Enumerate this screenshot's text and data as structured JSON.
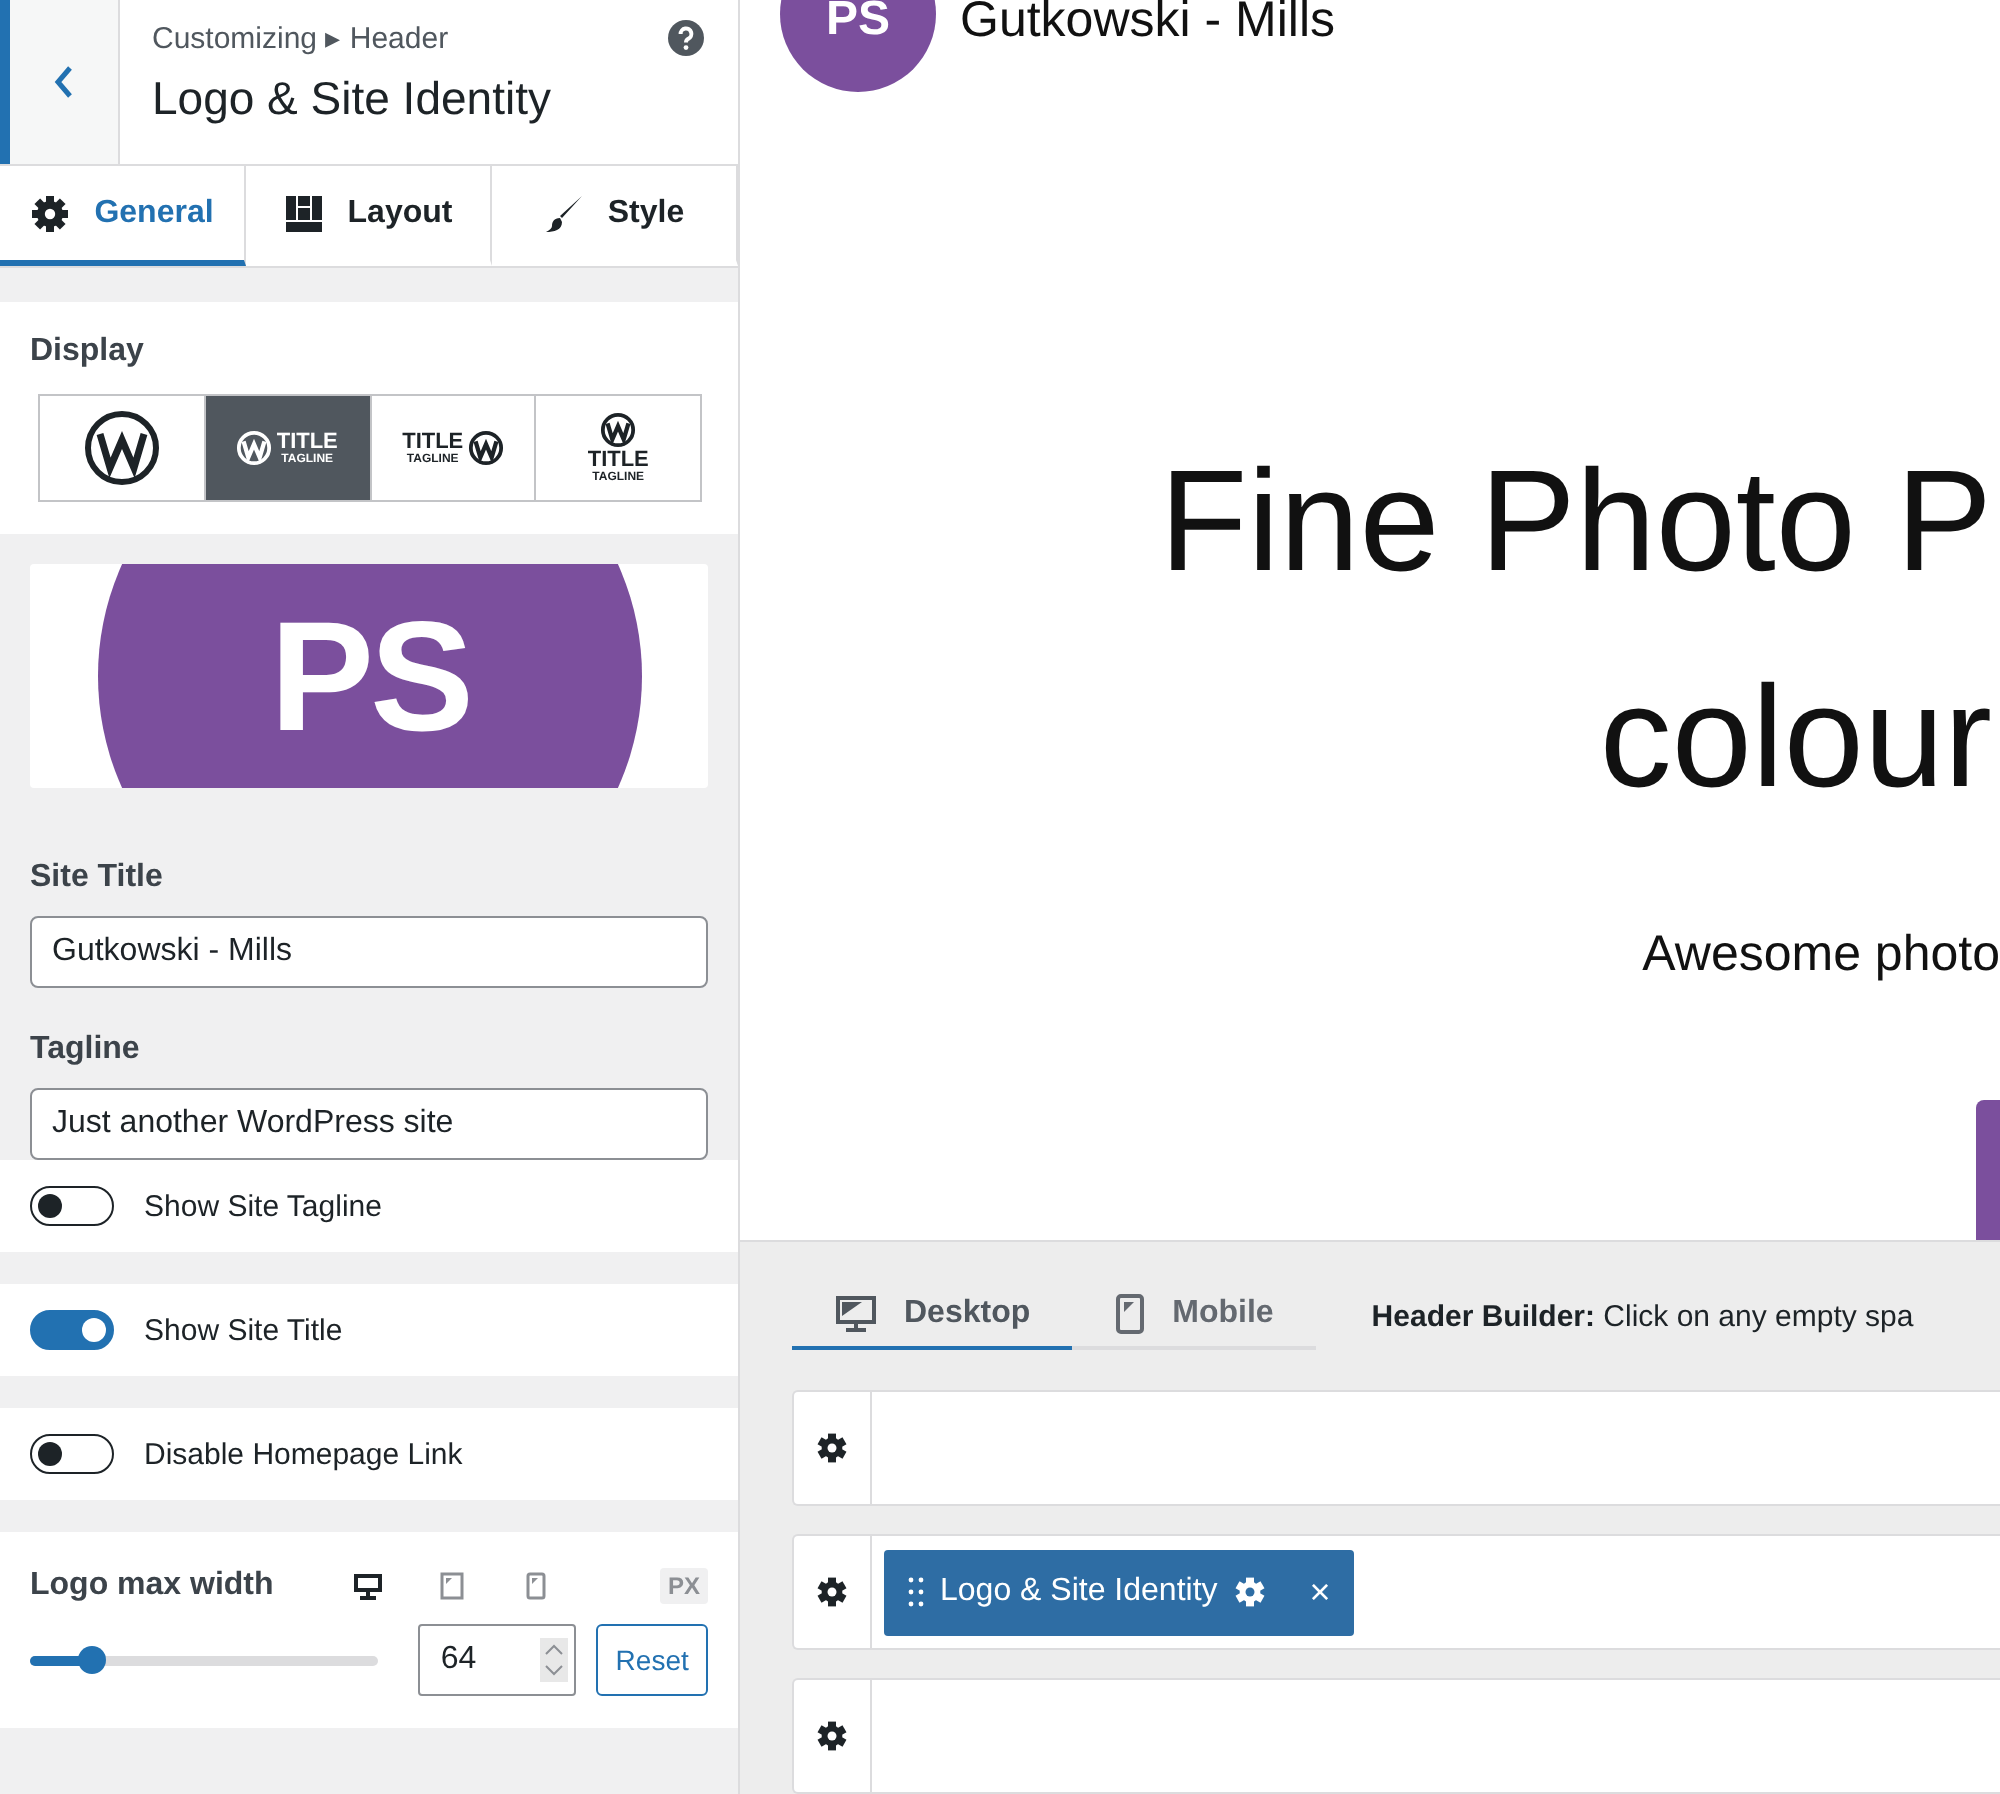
{
  "header": {
    "breadcrumb": "Customizing ▸ Header",
    "title": "Logo & Site Identity"
  },
  "tabs": [
    {
      "label": "General",
      "kind": "gear",
      "selected": true
    },
    {
      "label": "Layout",
      "kind": "layout",
      "selected": false
    },
    {
      "label": "Style",
      "kind": "brush",
      "selected": false
    }
  ],
  "display": {
    "label": "Display",
    "options": [
      {
        "kind": "logo",
        "selected": false
      },
      {
        "kind": "logo_left",
        "title": "TITLE",
        "tagline": "TAGLINE",
        "selected": true
      },
      {
        "kind": "logo_right",
        "title": "TITLE",
        "tagline": "TAGLINE",
        "selected": false
      },
      {
        "kind": "logo_top",
        "title": "TITLE",
        "tagline": "TAGLINE",
        "selected": false
      }
    ]
  },
  "logo": {
    "text": "PS"
  },
  "fields": [
    {
      "label": "Site Title",
      "value": "Gutkowski - Mills"
    },
    {
      "label": "Tagline",
      "value": "Just another WordPress site"
    }
  ],
  "toggles": [
    {
      "label": "Show Site Tagline",
      "on": false
    },
    {
      "label": "Show Site Title",
      "on": true
    },
    {
      "label": "Disable Homepage Link",
      "on": false
    }
  ],
  "logo_width": {
    "label": "Logo max width",
    "devices": [
      {
        "kind": "desktop",
        "selected": true
      },
      {
        "kind": "tablet",
        "selected": false
      },
      {
        "kind": "mobile",
        "selected": false
      }
    ],
    "unit": "PX",
    "level": 0.18,
    "value": "64",
    "reset": "Reset"
  },
  "preview": {
    "logo_text": "PS",
    "site_title": "Gutkowski - Mills",
    "heading_lines": [
      "Fine Photo P",
      "colour"
    ],
    "subtitle": "Awesome photo"
  },
  "builder": {
    "tabs": [
      {
        "label": "Desktop",
        "kind": "desktop",
        "selected": true
      },
      {
        "label": "Mobile",
        "kind": "mobile",
        "selected": false
      }
    ],
    "hint_label": "Header Builder:",
    "hint": "Click on any empty spa",
    "rows": [
      {
        "items": []
      },
      {
        "items": [
          {
            "label": "Logo & Site Identity",
            "close": "×"
          }
        ]
      },
      {
        "items": []
      }
    ]
  }
}
